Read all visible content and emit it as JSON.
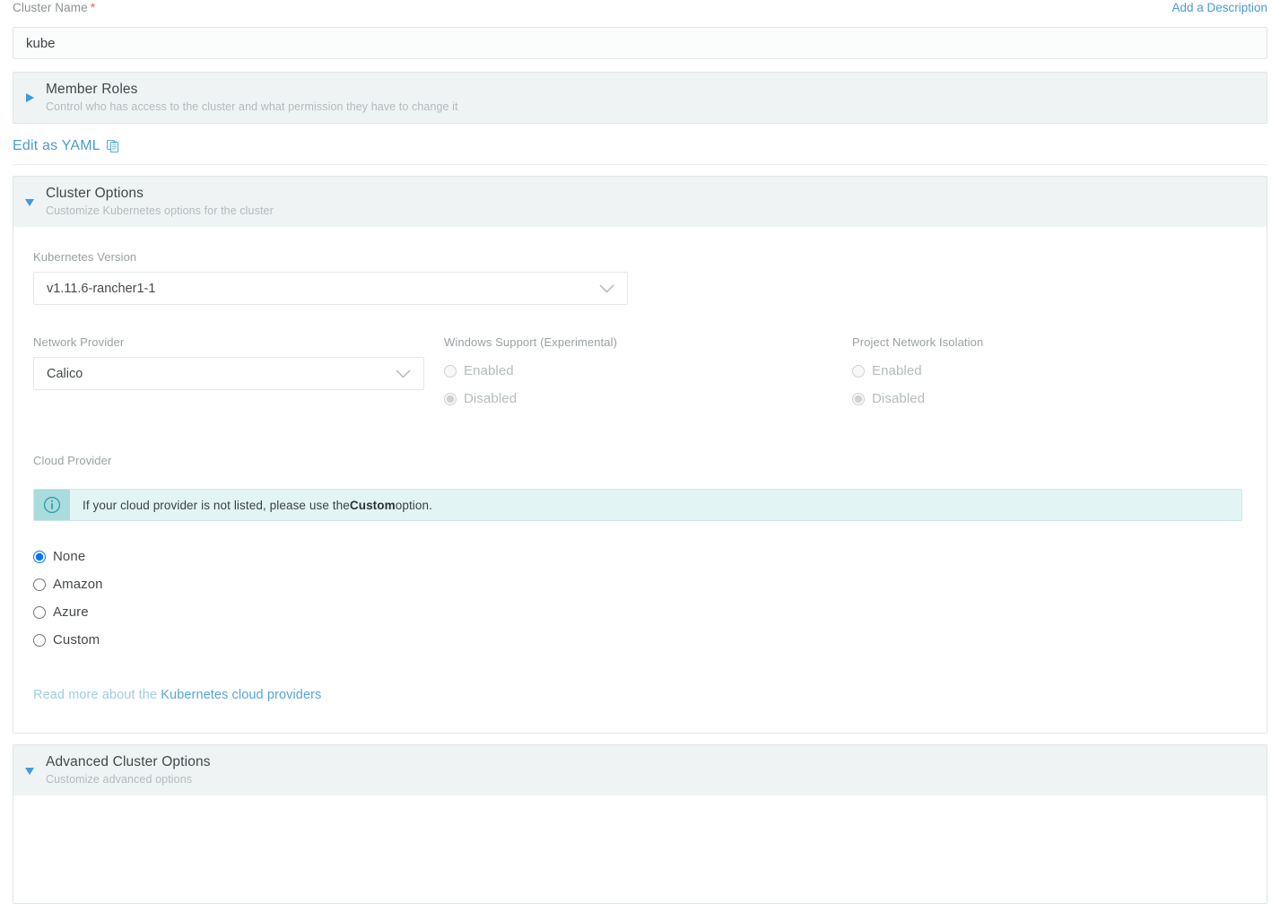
{
  "cluster_name": {
    "label": "Cluster Name",
    "required_marker": "*",
    "value": "kube",
    "placeholder": "",
    "add_description_link": "Add a Description"
  },
  "member_roles": {
    "title": "Member Roles",
    "subtitle": "Control who has access to the cluster and what permission they have to change it",
    "expanded": false,
    "caret_icon": "caret-right-icon"
  },
  "yaml": {
    "label": "Edit as YAML",
    "icon": "clipboard-copy-icon"
  },
  "cluster_options": {
    "title": "Cluster Options",
    "subtitle": "Customize Kubernetes options for the cluster",
    "expanded": true,
    "caret_icon": "caret-down-icon",
    "kubernetes_version": {
      "label": "Kubernetes Version",
      "value": "v1.11.6-rancher1-1",
      "chevron_icon": "chevron-down-icon"
    },
    "network_provider": {
      "label": "Network Provider",
      "value": "Calico",
      "chevron_icon": "chevron-down-icon"
    },
    "windows_support": {
      "label": "Windows Support (Experimental)",
      "disabled": true,
      "options": [
        {
          "label": "Enabled",
          "selected": false
        },
        {
          "label": "Disabled",
          "selected": true
        }
      ]
    },
    "project_network_isolation": {
      "label": "Project Network Isolation",
      "disabled": true,
      "options": [
        {
          "label": "Enabled",
          "selected": false
        },
        {
          "label": "Disabled",
          "selected": true
        }
      ]
    },
    "cloud_provider": {
      "label": "Cloud Provider",
      "banner": {
        "icon": "info-circle-icon",
        "text_before": "If your cloud provider is not listed, please use the ",
        "emphasis": "Custom",
        "text_after": " option."
      },
      "options": [
        {
          "label": "None",
          "selected": true
        },
        {
          "label": "Amazon",
          "selected": false
        },
        {
          "label": "Azure",
          "selected": false
        },
        {
          "label": "Custom",
          "selected": false
        }
      ],
      "readmore": {
        "prefix": "Read more about the ",
        "link_text": "Kubernetes cloud providers"
      }
    }
  },
  "advanced_cluster_options": {
    "title": "Advanced Cluster Options",
    "subtitle": "Customize advanced options",
    "expanded": true,
    "caret_icon": "caret-down-icon"
  },
  "colors": {
    "link": "#4a9bd4",
    "required": "#e8605f",
    "section_header_bg": "#eff3f4",
    "banner_bg": "#e3f4f5",
    "banner_icon_bg": "#aadbdd",
    "banner_icon": "#2b9ba3"
  }
}
